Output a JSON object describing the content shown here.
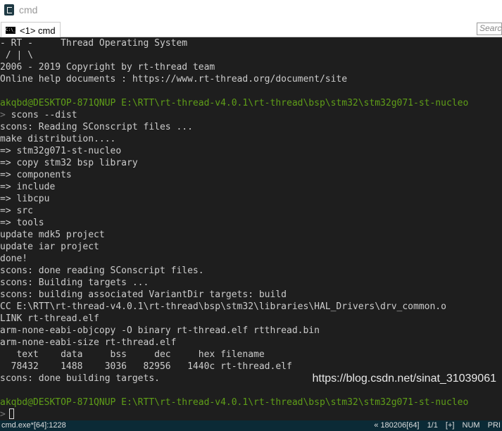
{
  "window": {
    "title": "cmd"
  },
  "tab": {
    "label": "<1> cmd",
    "icon_text": "C:\\_"
  },
  "search": {
    "placeholder": "Search"
  },
  "terminal": {
    "lines": [
      {
        "t": "- RT -     Thread Operating System",
        "c": ""
      },
      {
        "t": " / | \\",
        "c": ""
      },
      {
        "t": "2006 - 2019 Copyright by rt-thread team",
        "c": ""
      },
      {
        "t": "Online help documents : https://www.rt-thread.org/document/site",
        "c": ""
      },
      {
        "t": "",
        "c": ""
      },
      {
        "t": "akqbd@DESKTOP-871QNUP E:\\RTT\\rt-thread-v4.0.1\\rt-thread\\bsp\\stm32\\stm32g071-st-nucleo",
        "c": "green"
      },
      {
        "t": "> scons --dist",
        "c": "cmd"
      },
      {
        "t": "scons: Reading SConscript files ...",
        "c": ""
      },
      {
        "t": "make distribution....",
        "c": ""
      },
      {
        "t": "=> stm32g071-st-nucleo",
        "c": ""
      },
      {
        "t": "=> copy stm32 bsp library",
        "c": ""
      },
      {
        "t": "=> components",
        "c": ""
      },
      {
        "t": "=> include",
        "c": ""
      },
      {
        "t": "=> libcpu",
        "c": ""
      },
      {
        "t": "=> src",
        "c": ""
      },
      {
        "t": "=> tools",
        "c": ""
      },
      {
        "t": "update mdk5 project",
        "c": ""
      },
      {
        "t": "update iar project",
        "c": ""
      },
      {
        "t": "done!",
        "c": ""
      },
      {
        "t": "scons: done reading SConscript files.",
        "c": ""
      },
      {
        "t": "scons: Building targets ...",
        "c": ""
      },
      {
        "t": "scons: building associated VariantDir targets: build",
        "c": ""
      },
      {
        "t": "CC E:\\RTT\\rt-thread-v4.0.1\\rt-thread\\bsp\\stm32\\libraries\\HAL_Drivers\\drv_common.o",
        "c": ""
      },
      {
        "t": "LINK rt-thread.elf",
        "c": ""
      },
      {
        "t": "arm-none-eabi-objcopy -O binary rt-thread.elf rtthread.bin",
        "c": ""
      },
      {
        "t": "arm-none-eabi-size rt-thread.elf",
        "c": ""
      },
      {
        "t": "   text    data     bss     dec     hex filename",
        "c": ""
      },
      {
        "t": "  78432    1488    3036   82956   1440c rt-thread.elf",
        "c": ""
      },
      {
        "t": "scons: done building targets.",
        "c": ""
      },
      {
        "t": "",
        "c": ""
      },
      {
        "t": "akqbd@DESKTOP-871QNUP E:\\RTT\\rt-thread-v4.0.1\\rt-thread\\bsp\\stm32\\stm32g071-st-nucleo",
        "c": "green"
      }
    ],
    "prompt": ">"
  },
  "watermark": "https://blog.csdn.net/sinat_31039061",
  "status": {
    "left": "cmd.exe*[64]:1228",
    "items": [
      "« 180206[64]",
      "1/1",
      "[+]",
      "NUM",
      "PRI"
    ]
  }
}
